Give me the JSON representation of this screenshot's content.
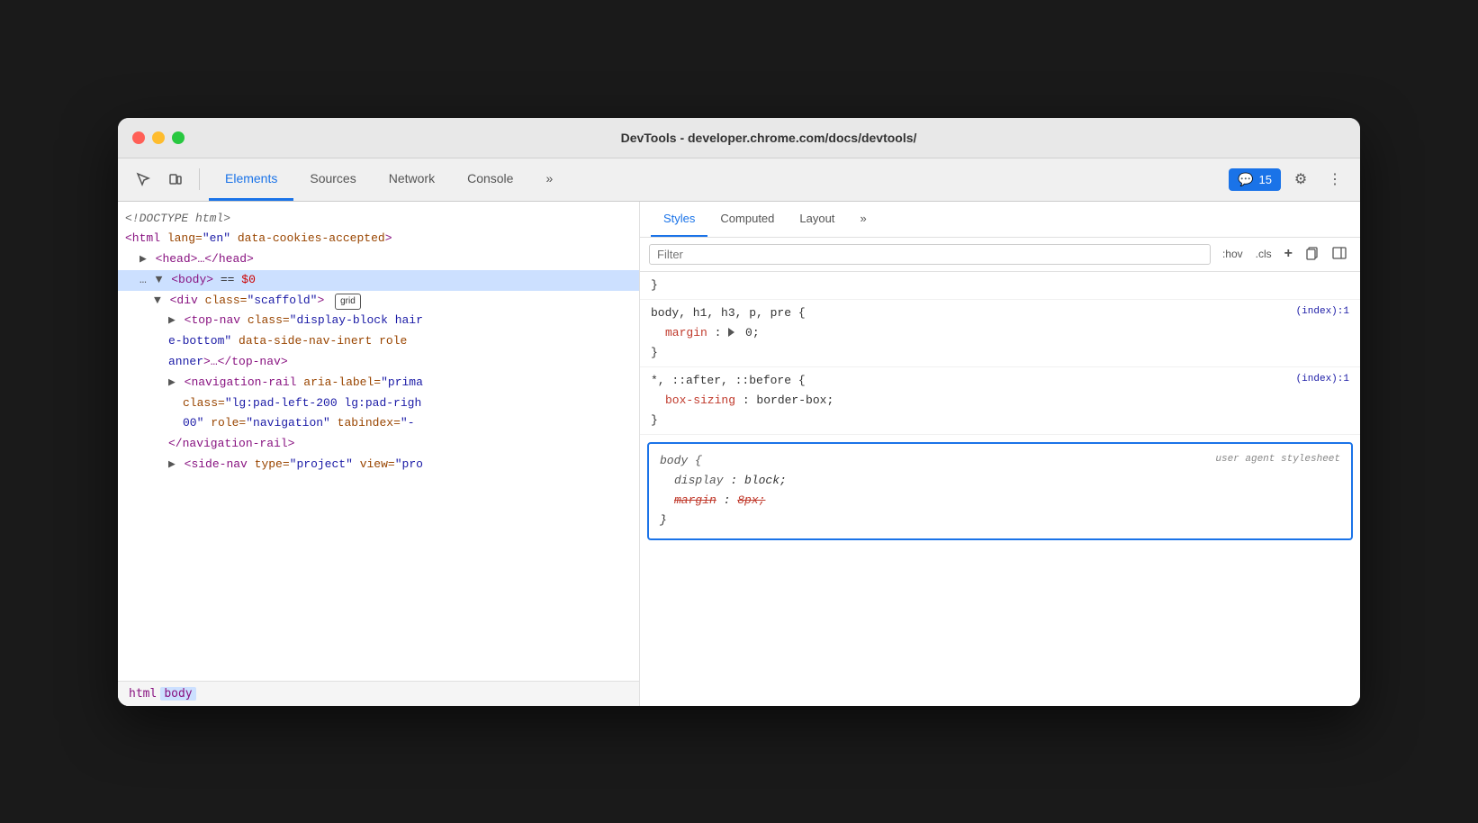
{
  "window": {
    "title": "DevTools - developer.chrome.com/docs/devtools/"
  },
  "toolbar": {
    "tabs": [
      {
        "id": "elements",
        "label": "Elements",
        "active": true
      },
      {
        "id": "sources",
        "label": "Sources",
        "active": false
      },
      {
        "id": "network",
        "label": "Network",
        "active": false
      },
      {
        "id": "console",
        "label": "Console",
        "active": false
      }
    ],
    "more_label": "»",
    "badge_count": "15",
    "gear_label": "⚙",
    "more_vert_label": "⋮"
  },
  "elements_panel": {
    "lines": [
      {
        "id": "doctype",
        "text": "<!DOCTYPE html>"
      },
      {
        "id": "html-open",
        "text": "<html lang=\"en\" data-cookies-accepted>"
      },
      {
        "id": "head",
        "text": "▶ <head>…</head>"
      },
      {
        "id": "body",
        "text": "▼ <body> == $0",
        "selected": true
      },
      {
        "id": "div-scaffold",
        "text": "▼<div class=\"scaffold\"> grid"
      },
      {
        "id": "top-nav",
        "text": "▶<top-nav class=\"display-block hair"
      },
      {
        "id": "top-nav-2",
        "text": "e-bottom\" data-side-nav-inert role"
      },
      {
        "id": "top-nav-3",
        "text": "anner\">…</top-nav>"
      },
      {
        "id": "nav-rail",
        "text": "▶<navigation-rail aria-label=\"prima"
      },
      {
        "id": "nav-rail-2",
        "text": "class=\"lg:pad-left-200 lg:pad-righ"
      },
      {
        "id": "nav-rail-3",
        "text": "00\" role=\"navigation\" tabindex=\"-"
      },
      {
        "id": "nav-rail-4",
        "text": "</navigation-rail>"
      },
      {
        "id": "side-nav",
        "text": "▶<side-nav type=\"project\" view=\"pro"
      }
    ],
    "breadcrumb": [
      "html",
      "body"
    ]
  },
  "styles_panel": {
    "tabs": [
      {
        "id": "styles",
        "label": "Styles",
        "active": true
      },
      {
        "id": "computed",
        "label": "Computed",
        "active": false
      },
      {
        "id": "layout",
        "label": "Layout",
        "active": false
      }
    ],
    "filter_placeholder": "Filter",
    "filter_actions": [
      ":hov",
      ".cls",
      "+"
    ],
    "rules": [
      {
        "id": "rule1",
        "selector": "body, h1, h3, p, pre {",
        "source": "(index):1",
        "properties": [
          {
            "name": "margin",
            "value": "▶ 0",
            "strikethrough": false
          }
        ],
        "close": "}"
      },
      {
        "id": "rule2",
        "selector": "*, ::after, ::before {",
        "source": "(index):1",
        "properties": [
          {
            "name": "box-sizing",
            "value": "border-box",
            "strikethrough": false
          }
        ],
        "close": "}"
      },
      {
        "id": "rule3",
        "selector": "body {",
        "source": "user agent stylesheet",
        "highlighted": true,
        "properties": [
          {
            "name": "display",
            "value": "block",
            "strikethrough": false,
            "italic": true
          },
          {
            "name": "margin",
            "value": "8px",
            "strikethrough": true,
            "italic": true
          }
        ],
        "close": "}"
      }
    ]
  }
}
